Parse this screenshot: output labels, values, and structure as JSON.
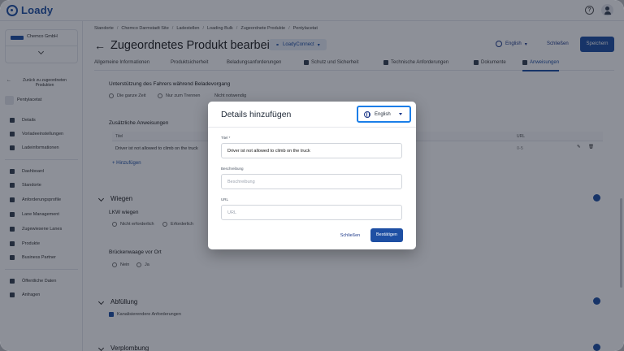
{
  "app": {
    "name": "Loady"
  },
  "sidebar": {
    "company": "Chemco GmbH",
    "back_link": "Zurück zu zugeordneten Produkten",
    "product": "Pentylacetat",
    "group1": [
      "Details",
      "Vorladeeinstellungen",
      "Ladeinformationen"
    ],
    "group2": [
      "Dashboard",
      "Standorte",
      "Anforderungsprofile",
      "Lane Management",
      "Zugewiesene Lanes",
      "Produkte",
      "Business Partner"
    ],
    "group3": [
      "Öffentliche Daten",
      "Anfragen"
    ]
  },
  "breadcrumb": [
    "Standorte",
    "Chemco Darmstadt Site",
    "Ladestellen",
    "Loading Bulk",
    "Zugeordnete Produkte",
    "Pentylacetat"
  ],
  "header": {
    "title": "Zugeordnetes Produkt bearbeiten",
    "loady_connect": "LoadyConnect",
    "language": "English",
    "close_label": "Schließen",
    "save_label": "Speichern"
  },
  "tabs": [
    "Allgemeine Informationen",
    "Produktsicherheit",
    "Beladungsanforderungen",
    "Schutz und Sicherheit",
    "Technische Anforderungen",
    "Dokumente",
    "Anweisungen"
  ],
  "content": {
    "driver_support_label": "Unterstützung des Fahrers während Beladevorgang",
    "driver_support_options": [
      "Die ganze Zeit",
      "Nur zum Trennen",
      "Nicht notwendig"
    ],
    "additional_instructions_label": "Zusätzliche Anweisungen",
    "table_columns": [
      "Titel",
      "URL"
    ],
    "table_rows": [
      {
        "title": "Driver ist not allowed to climb on the truck",
        "url": "0-5"
      }
    ],
    "add_instruction": "+ Hinzufügen",
    "weighing_section": "Wiegen",
    "truck_weighing_label": "LKW wiegen",
    "truck_weighing_options": [
      "Nicht erforderlich",
      "Erforderlich"
    ],
    "bridge_scale_label": "Brückenwaage vor Ort",
    "bridge_scale_options": [
      "Nein",
      "Ja"
    ],
    "filling_section": "Abfüllung",
    "filling_checkbox": "Kanalisierendere Anforderungen",
    "sealing_section": "Verplombung"
  },
  "modal": {
    "title": "Details hinzufügen",
    "language": "English",
    "title_label": "Titel *",
    "title_value": "Driver ist not allowed to climb on the truck",
    "description_label": "Beschreibung",
    "description_placeholder": "Beschreibung",
    "url_label": "URL",
    "url_placeholder": "URL",
    "close_label": "Schließen",
    "confirm_label": "Bestätigen"
  },
  "colors": {
    "primary": "#1e4fa3",
    "focus_outline": "#1a7ee8",
    "overlay": "rgba(17,24,39,0.48)"
  }
}
